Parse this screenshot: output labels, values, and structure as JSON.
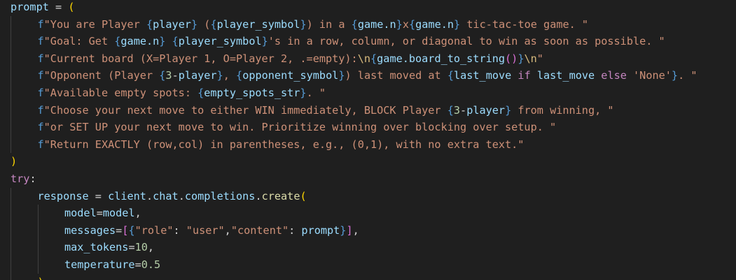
{
  "lines": [
    {
      "indent": 0,
      "tokens": [
        {
          "t": "prompt",
          "c": "v"
        },
        {
          "t": " = ",
          "c": "o"
        },
        {
          "t": "(",
          "c": "g"
        }
      ]
    },
    {
      "indent": 1,
      "tokens": [
        {
          "t": "f",
          "c": "b"
        },
        {
          "t": "\"You are Player ",
          "c": "s"
        },
        {
          "t": "{",
          "c": "b"
        },
        {
          "t": "player",
          "c": "v"
        },
        {
          "t": "}",
          "c": "b"
        },
        {
          "t": " (",
          "c": "s"
        },
        {
          "t": "{",
          "c": "b"
        },
        {
          "t": "player_symbol",
          "c": "v"
        },
        {
          "t": "}",
          "c": "b"
        },
        {
          "t": ") in a ",
          "c": "s"
        },
        {
          "t": "{",
          "c": "b"
        },
        {
          "t": "game.n",
          "c": "v"
        },
        {
          "t": "}",
          "c": "b"
        },
        {
          "t": "x",
          "c": "s"
        },
        {
          "t": "{",
          "c": "b"
        },
        {
          "t": "game.n",
          "c": "v"
        },
        {
          "t": "}",
          "c": "b"
        },
        {
          "t": " tic-tac-toe game. \"",
          "c": "s"
        }
      ]
    },
    {
      "indent": 1,
      "tokens": [
        {
          "t": "f",
          "c": "b"
        },
        {
          "t": "\"Goal: Get ",
          "c": "s"
        },
        {
          "t": "{",
          "c": "b"
        },
        {
          "t": "game.n",
          "c": "v"
        },
        {
          "t": "}",
          "c": "b"
        },
        {
          "t": " ",
          "c": "s"
        },
        {
          "t": "{",
          "c": "b"
        },
        {
          "t": "player_symbol",
          "c": "v"
        },
        {
          "t": "}",
          "c": "b"
        },
        {
          "t": "'s in a row, column, or diagonal to win as soon as possible. \"",
          "c": "s"
        }
      ]
    },
    {
      "indent": 1,
      "tokens": [
        {
          "t": "f",
          "c": "b"
        },
        {
          "t": "\"Current board (X=Player 1, O=Player 2, .=empty):",
          "c": "s"
        },
        {
          "t": "\\n",
          "c": "e"
        },
        {
          "t": "{",
          "c": "b"
        },
        {
          "t": "game.board_to_string",
          "c": "v"
        },
        {
          "t": "()",
          "c": "p"
        },
        {
          "t": "}",
          "c": "b"
        },
        {
          "t": "\\n",
          "c": "e"
        },
        {
          "t": "\"",
          "c": "s"
        }
      ]
    },
    {
      "indent": 1,
      "tokens": [
        {
          "t": "f",
          "c": "b"
        },
        {
          "t": "\"Opponent (Player ",
          "c": "s"
        },
        {
          "t": "{",
          "c": "b"
        },
        {
          "t": "3",
          "c": "n"
        },
        {
          "t": "-",
          "c": "o"
        },
        {
          "t": "player",
          "c": "v"
        },
        {
          "t": "}",
          "c": "b"
        },
        {
          "t": ", ",
          "c": "s"
        },
        {
          "t": "{",
          "c": "b"
        },
        {
          "t": "opponent_symbol",
          "c": "v"
        },
        {
          "t": "}",
          "c": "b"
        },
        {
          "t": ") last moved at ",
          "c": "s"
        },
        {
          "t": "{",
          "c": "b"
        },
        {
          "t": "last_move",
          "c": "v"
        },
        {
          "t": " if ",
          "c": "k"
        },
        {
          "t": "last_move",
          "c": "v"
        },
        {
          "t": " else ",
          "c": "k"
        },
        {
          "t": "'None'",
          "c": "s"
        },
        {
          "t": "}",
          "c": "b"
        },
        {
          "t": ". \"",
          "c": "s"
        }
      ]
    },
    {
      "indent": 1,
      "tokens": [
        {
          "t": "f",
          "c": "b"
        },
        {
          "t": "\"Available empty spots: ",
          "c": "s"
        },
        {
          "t": "{",
          "c": "b"
        },
        {
          "t": "empty_spots_str",
          "c": "v"
        },
        {
          "t": "}",
          "c": "b"
        },
        {
          "t": ". \"",
          "c": "s"
        }
      ]
    },
    {
      "indent": 1,
      "tokens": [
        {
          "t": "f",
          "c": "b"
        },
        {
          "t": "\"Choose your next move to either WIN immediately, BLOCK Player ",
          "c": "s"
        },
        {
          "t": "{",
          "c": "b"
        },
        {
          "t": "3",
          "c": "n"
        },
        {
          "t": "-",
          "c": "o"
        },
        {
          "t": "player",
          "c": "v"
        },
        {
          "t": "}",
          "c": "b"
        },
        {
          "t": " from winning, \"",
          "c": "s"
        }
      ]
    },
    {
      "indent": 1,
      "tokens": [
        {
          "t": "f",
          "c": "b"
        },
        {
          "t": "\"or SET UP your next move to win. Prioritize winning over blocking over setup. \"",
          "c": "s"
        }
      ]
    },
    {
      "indent": 1,
      "tokens": [
        {
          "t": "f",
          "c": "b"
        },
        {
          "t": "\"Return EXACTLY (row,col) in parentheses, e.g., (0,1), with no extra text.\"",
          "c": "s"
        }
      ]
    },
    {
      "indent": 0,
      "tokens": [
        {
          "t": ")",
          "c": "g"
        }
      ]
    },
    {
      "indent": 0,
      "tokens": [
        {
          "t": "try",
          "c": "k"
        },
        {
          "t": ":",
          "c": "o"
        }
      ]
    },
    {
      "indent": 1,
      "tokens": [
        {
          "t": "response",
          "c": "v"
        },
        {
          "t": " = ",
          "c": "o"
        },
        {
          "t": "client",
          "c": "v"
        },
        {
          "t": ".",
          "c": "o"
        },
        {
          "t": "chat",
          "c": "v"
        },
        {
          "t": ".",
          "c": "o"
        },
        {
          "t": "completions",
          "c": "v"
        },
        {
          "t": ".",
          "c": "o"
        },
        {
          "t": "create",
          "c": "f"
        },
        {
          "t": "(",
          "c": "g"
        }
      ]
    },
    {
      "indent": 2,
      "tokens": [
        {
          "t": "model",
          "c": "v"
        },
        {
          "t": "=",
          "c": "o"
        },
        {
          "t": "model",
          "c": "v"
        },
        {
          "t": ",",
          "c": "o"
        }
      ]
    },
    {
      "indent": 2,
      "tokens": [
        {
          "t": "messages",
          "c": "v"
        },
        {
          "t": "=",
          "c": "o"
        },
        {
          "t": "[",
          "c": "p"
        },
        {
          "t": "{",
          "c": "b"
        },
        {
          "t": "\"role\"",
          "c": "s"
        },
        {
          "t": ": ",
          "c": "o"
        },
        {
          "t": "\"user\"",
          "c": "s"
        },
        {
          "t": ",",
          "c": "o"
        },
        {
          "t": "\"content\"",
          "c": "s"
        },
        {
          "t": ": ",
          "c": "o"
        },
        {
          "t": "prompt",
          "c": "v"
        },
        {
          "t": "}",
          "c": "b"
        },
        {
          "t": "]",
          "c": "p"
        },
        {
          "t": ",",
          "c": "o"
        }
      ]
    },
    {
      "indent": 2,
      "tokens": [
        {
          "t": "max_tokens",
          "c": "v"
        },
        {
          "t": "=",
          "c": "o"
        },
        {
          "t": "10",
          "c": "n"
        },
        {
          "t": ",",
          "c": "o"
        }
      ]
    },
    {
      "indent": 2,
      "tokens": [
        {
          "t": "temperature",
          "c": "v"
        },
        {
          "t": "=",
          "c": "o"
        },
        {
          "t": "0.5",
          "c": "n"
        }
      ]
    },
    {
      "indent": 1,
      "tokens": [
        {
          "t": ")",
          "c": "g"
        }
      ]
    }
  ]
}
